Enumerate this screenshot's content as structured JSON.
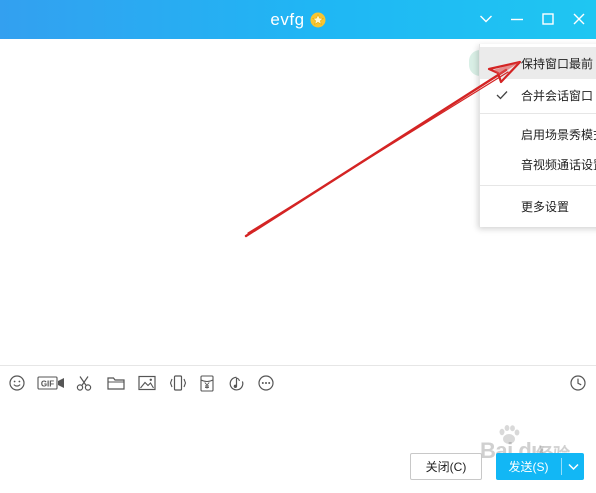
{
  "window": {
    "title": "evfg",
    "controls": [
      "chevron-down-icon",
      "minimize-icon",
      "maximize-icon",
      "close-icon"
    ]
  },
  "toolbar": {
    "items": [
      "emoji-icon",
      "gif-icon",
      "scissors-icon",
      "folder-icon",
      "image-icon",
      "shake-icon",
      "red-packet-icon",
      "music-icon",
      "more-icon",
      "history-icon"
    ],
    "gif_label": "GIF"
  },
  "buttons": {
    "close_label": "关闭(C)",
    "send_label": "发送(S)"
  },
  "menu": {
    "items": [
      {
        "label": "保持窗口最前",
        "highlighted": true,
        "checked": false
      },
      {
        "label": "合并会话窗口",
        "highlighted": false,
        "checked": true
      },
      {
        "label": "启用场景秀模式",
        "highlighted": false,
        "checked": false
      },
      {
        "label": "音视频通话设置",
        "highlighted": false,
        "checked": false
      },
      {
        "label": "更多设置",
        "highlighted": false,
        "checked": false
      }
    ]
  },
  "watermark": {
    "brand": "Bai du",
    "suffix": "经验",
    "url": "jingyan.baidu.com"
  },
  "colors": {
    "titlebar_start": "#33a0f0",
    "titlebar_end": "#1fc6f2",
    "send_button": "#12b7f5",
    "annotation_arrow": "#d42424"
  }
}
